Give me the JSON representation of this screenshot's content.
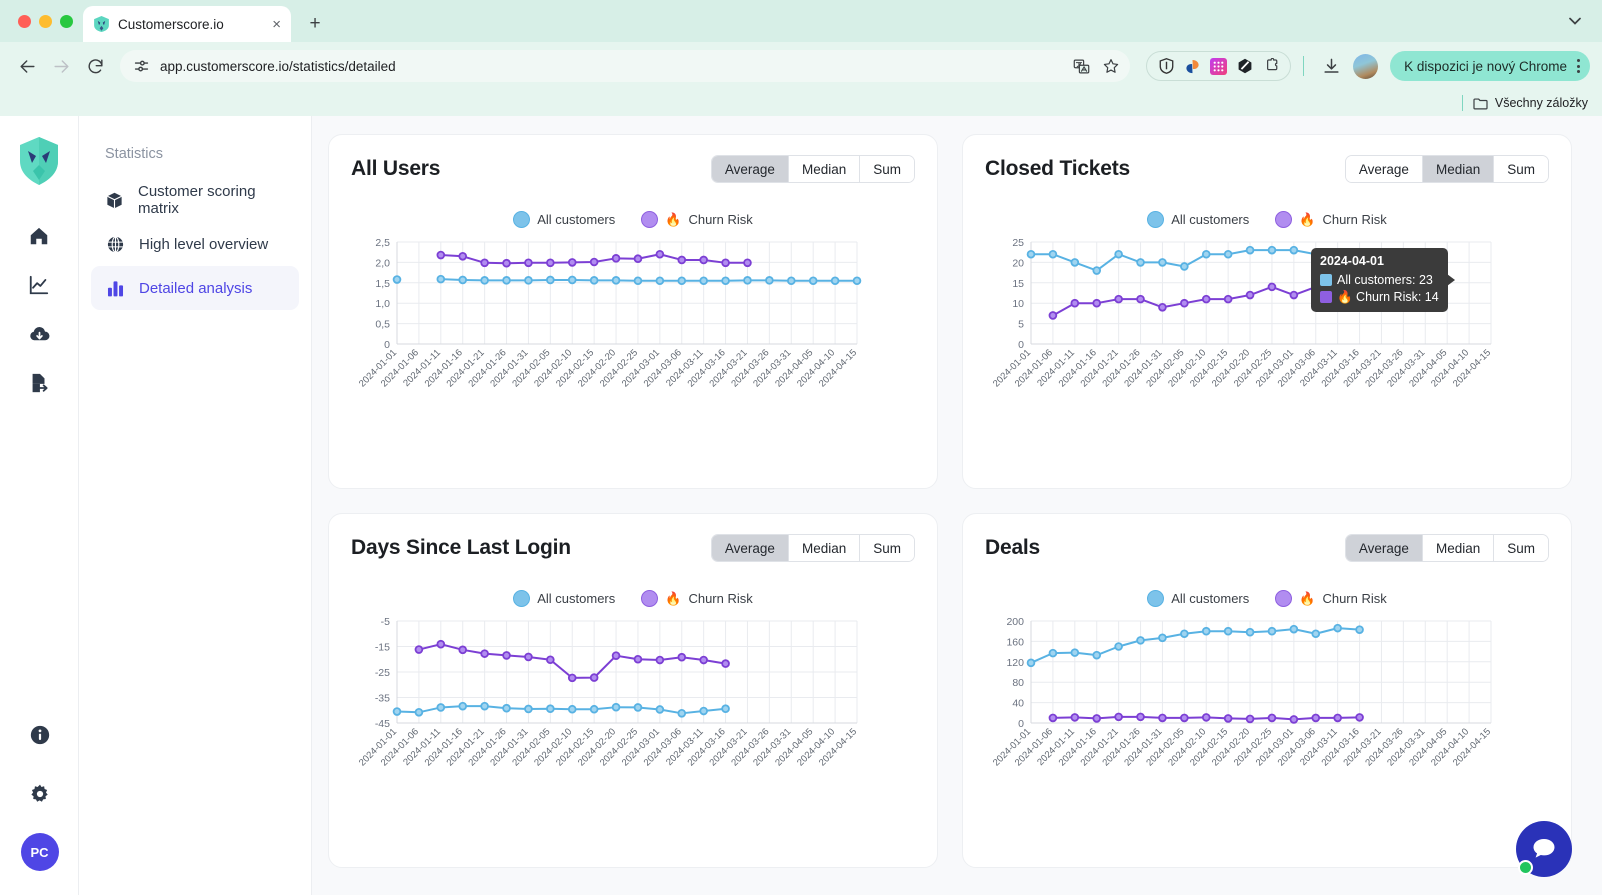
{
  "browser": {
    "tab": {
      "title": "Customerscore.io",
      "favicon": "app-logo-icon",
      "close": "×"
    },
    "new_tab_label": "+",
    "url": "app.customerscore.io/statistics/detailed",
    "update_button": "K dispozici je nový Chrome",
    "bookmarks_label": "Všechny záložky",
    "icons": {
      "back": "back-arrow-icon",
      "forward": "forward-arrow-icon",
      "reload": "reload-icon",
      "site_settings": "site-settings-icon",
      "translate": "translate-icon",
      "bookmark": "star-icon",
      "download": "download-icon",
      "profile": "profile-avatar",
      "menu": "kebab-menu-icon",
      "folder": "folder-icon",
      "tab_list": "chevron-down-icon"
    },
    "extensions": [
      "shield-extension-icon",
      "sourcegraph-extension-icon",
      "grid-extension-icon",
      "hex-extension-icon",
      "puzzle-extensions-icon"
    ]
  },
  "sidebar": {
    "rail_icons": [
      "home-icon",
      "analytics-icon",
      "cloud-download-icon",
      "export-icon"
    ],
    "bottom_icons": [
      "info-icon",
      "gear-icon"
    ],
    "user_initials": "PC"
  },
  "nav": {
    "heading": "Statistics",
    "items": [
      {
        "label": "Customer scoring matrix",
        "icon": "box-icon",
        "active": false
      },
      {
        "label": "High level overview",
        "icon": "globe-icon",
        "active": false
      },
      {
        "label": "Detailed analysis",
        "icon": "bar-chart-icon",
        "active": true
      }
    ]
  },
  "segments": {
    "options": [
      "Average",
      "Median",
      "Sum"
    ]
  },
  "legend": {
    "all_customers": "All customers",
    "churn_risk": "Churn Risk",
    "churn_emoji": "🔥",
    "color_all": "#7dc3ea",
    "color_churn": "#7c3fd4"
  },
  "tooltip": {
    "visible_on": "Closed Tickets",
    "date": "2024-04-01",
    "rows": [
      {
        "label": "All customers: 23",
        "color": "#7dc3ea"
      },
      {
        "label": "🔥 Churn Risk: 14",
        "color": "#8e5fe0"
      }
    ]
  },
  "chart_data": [
    {
      "type": "line",
      "title": "All Users",
      "selected_metric": "Average",
      "xlabel": "",
      "ylabel": "",
      "ylim": [
        0,
        2.5
      ],
      "yticks": [
        "0",
        "0,5",
        "1,0",
        "1,5",
        "2,0",
        "2,5"
      ],
      "ytick_values": [
        0,
        0.5,
        1.0,
        1.5,
        2.0,
        2.5
      ],
      "grid": true,
      "legend_position": "top-center",
      "categories": [
        "2024-01-01",
        "2024-01-06",
        "2024-01-11",
        "2024-01-16",
        "2024-01-21",
        "2024-01-26",
        "2024-01-31",
        "2024-02-05",
        "2024-02-10",
        "2024-02-15",
        "2024-02-20",
        "2024-02-25",
        "2024-03-01",
        "2024-03-06",
        "2024-03-11",
        "2024-03-16",
        "2024-03-21",
        "2024-03-26",
        "2024-03-31",
        "2024-04-05",
        "2024-04-10",
        "2024-04-15"
      ],
      "series": [
        {
          "name": "All customers",
          "color": "#58b2e3",
          "values": [
            1.58,
            null,
            1.59,
            1.57,
            1.56,
            1.56,
            1.56,
            1.57,
            1.57,
            1.56,
            1.56,
            1.55,
            1.55,
            1.55,
            1.55,
            1.55,
            1.56,
            1.56,
            1.55,
            1.55,
            1.55,
            1.55
          ]
        },
        {
          "name": "Churn Risk",
          "color": "#7c3fd4",
          "values": [
            null,
            null,
            2.18,
            2.15,
            1.99,
            1.98,
            1.99,
            1.99,
            2.0,
            2.01,
            2.1,
            2.09,
            2.2,
            2.06,
            2.06,
            1.99,
            1.99,
            null,
            null,
            null,
            null,
            null
          ]
        }
      ]
    },
    {
      "type": "line",
      "title": "Closed Tickets",
      "selected_metric": "Median",
      "xlabel": "",
      "ylabel": "",
      "ylim": [
        0,
        25
      ],
      "yticks": [
        "0",
        "5",
        "10",
        "15",
        "20",
        "25"
      ],
      "ytick_values": [
        0,
        5,
        10,
        15,
        20,
        25
      ],
      "grid": true,
      "legend_position": "top-center",
      "categories": [
        "2024-01-01",
        "2024-01-06",
        "2024-01-11",
        "2024-01-16",
        "2024-01-21",
        "2024-01-26",
        "2024-01-31",
        "2024-02-05",
        "2024-02-10",
        "2024-02-15",
        "2024-02-20",
        "2024-02-25",
        "2024-03-01",
        "2024-03-06",
        "2024-03-11",
        "2024-03-16",
        "2024-03-21",
        "2024-03-26",
        "2024-03-31",
        "2024-04-05",
        "2024-04-10",
        "2024-04-15"
      ],
      "series": [
        {
          "name": "All customers",
          "color": "#58b2e3",
          "values": [
            22,
            22,
            20,
            18,
            22,
            20,
            20,
            19,
            22,
            22,
            23,
            23,
            23,
            22,
            20,
            null,
            null,
            null,
            null,
            null,
            null,
            null
          ]
        },
        {
          "name": "Churn Risk",
          "color": "#7c3fd4",
          "values": [
            null,
            7,
            10,
            10,
            11,
            11,
            9,
            10,
            11,
            11,
            12,
            14,
            12,
            14,
            13,
            12,
            null,
            null,
            null,
            null,
            null,
            null
          ]
        }
      ]
    },
    {
      "type": "line",
      "title": "Days Since Last Login",
      "selected_metric": "Average",
      "xlabel": "",
      "ylabel": "",
      "ylim": [
        -45,
        -5
      ],
      "yticks": [
        "-45",
        "-35",
        "-25",
        "-15",
        "-5"
      ],
      "ytick_values": [
        -45,
        -35,
        -25,
        -15,
        -5
      ],
      "grid": true,
      "legend_position": "top-center",
      "categories": [
        "2024-01-01",
        "2024-01-06",
        "2024-01-11",
        "2024-01-16",
        "2024-01-21",
        "2024-01-26",
        "2024-01-31",
        "2024-02-05",
        "2024-02-10",
        "2024-02-15",
        "2024-02-20",
        "2024-02-25",
        "2024-03-01",
        "2024-03-06",
        "2024-03-11",
        "2024-03-16",
        "2024-03-21",
        "2024-03-26",
        "2024-03-31",
        "2024-04-05",
        "2024-04-10",
        "2024-04-15"
      ],
      "series": [
        {
          "name": "All customers",
          "color": "#58b2e3",
          "values": [
            -40.5,
            -40.8,
            -38.9,
            -38.4,
            -38.4,
            -39.2,
            -39.5,
            -39.4,
            -39.6,
            -39.6,
            -38.8,
            -38.9,
            -39.7,
            -41.2,
            -40.3,
            -39.4,
            null,
            null,
            null,
            null,
            null,
            null
          ]
        },
        {
          "name": "Churn Risk",
          "color": "#7c3fd4",
          "values": [
            null,
            -16.2,
            -14.1,
            -16.3,
            -17.8,
            -18.5,
            -19.1,
            -20.2,
            -27.3,
            -27.2,
            -18.6,
            -20.0,
            -20.3,
            -19.2,
            -20.3,
            -21.7,
            null,
            null,
            null,
            null,
            null,
            null
          ]
        }
      ]
    },
    {
      "type": "line",
      "title": "Deals",
      "selected_metric": "Average",
      "xlabel": "",
      "ylabel": "",
      "ylim": [
        0,
        200
      ],
      "yticks": [
        "0",
        "40",
        "80",
        "120",
        "160",
        "200"
      ],
      "ytick_values": [
        0,
        40,
        80,
        120,
        160,
        200
      ],
      "grid": true,
      "legend_position": "top-center",
      "categories": [
        "2024-01-01",
        "2024-01-06",
        "2024-01-11",
        "2024-01-16",
        "2024-01-21",
        "2024-01-26",
        "2024-01-31",
        "2024-02-05",
        "2024-02-10",
        "2024-02-15",
        "2024-02-20",
        "2024-02-25",
        "2024-03-01",
        "2024-03-06",
        "2024-03-11",
        "2024-03-16",
        "2024-03-21",
        "2024-03-26",
        "2024-03-31",
        "2024-04-05",
        "2024-04-10",
        "2024-04-15"
      ],
      "series": [
        {
          "name": "All customers",
          "color": "#58b2e3",
          "values": [
            118,
            137,
            138,
            133,
            150,
            162,
            167,
            175,
            180,
            180,
            178,
            180,
            184,
            175,
            186,
            183,
            null,
            null,
            null,
            null,
            null,
            null
          ]
        },
        {
          "name": "Churn Risk",
          "color": "#7c3fd4",
          "values": [
            null,
            10,
            11,
            9,
            12,
            12,
            10,
            10,
            11,
            9,
            8,
            10,
            7,
            10,
            10,
            11,
            null,
            null,
            null,
            null,
            null,
            null
          ]
        }
      ]
    }
  ]
}
